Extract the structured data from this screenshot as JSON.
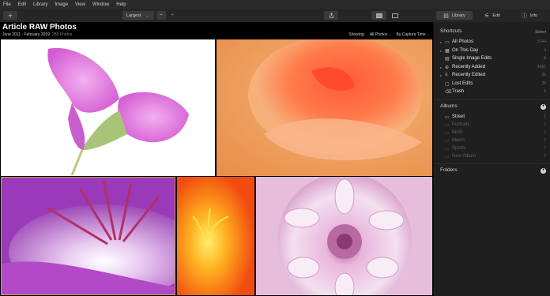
{
  "menu": [
    "File",
    "Edit",
    "Library",
    "Image",
    "View",
    "Window",
    "Help"
  ],
  "toolbar": {
    "add_label": "+",
    "size_select": "Largest",
    "zoom_out": "−",
    "zoom_in": "+",
    "share_icon": "share-icon",
    "view_grid_icon": "grid-view-icon",
    "view_single_icon": "single-view-icon"
  },
  "right_tabs": [
    {
      "label": "Library",
      "icon": "library-icon",
      "active": true
    },
    {
      "label": "Edit",
      "icon": "edit-icon",
      "active": false
    },
    {
      "label": "Info",
      "icon": "info-icon",
      "active": false
    }
  ],
  "gallery": {
    "title": "Article RAW Photos",
    "date_range": "June 2011 - February 2019",
    "photo_count": "288 Photos",
    "showing_label": "Showing:",
    "showing_value": "All Photos",
    "sort_value": "By Capture Time"
  },
  "shortcuts": {
    "title": "Shortcuts",
    "action": "Select",
    "items": [
      {
        "label": "All Photos",
        "count": "5744",
        "icon": "photos-icon",
        "expandable": true
      },
      {
        "label": "On This Day",
        "count": "4",
        "icon": "calendar-icon",
        "expandable": true
      },
      {
        "label": "Single Image Edits",
        "count": "8",
        "icon": "single-image-icon",
        "expandable": false
      },
      {
        "label": "Recently Added",
        "count": "4391",
        "icon": "recently-added-icon",
        "expandable": true
      },
      {
        "label": "Recently Edited",
        "count": "26",
        "icon": "recently-edited-icon",
        "expandable": true
      },
      {
        "label": "Lost Edits",
        "count": "25",
        "icon": "lost-edits-icon",
        "expandable": false
      },
      {
        "label": "Trash",
        "count": "6",
        "icon": "trash-icon",
        "expandable": false
      }
    ]
  },
  "albums": {
    "title": "Albums",
    "items": [
      {
        "label": "Street",
        "count": "1",
        "dim": false
      },
      {
        "label": "Portraits",
        "count": "0",
        "dim": true
      },
      {
        "label": "Birds",
        "count": "0",
        "dim": true
      },
      {
        "label": "Macro",
        "count": "0",
        "dim": true
      },
      {
        "label": "Sports",
        "count": "0",
        "dim": true
      },
      {
        "label": "New Album",
        "count": "0",
        "dim": true
      }
    ]
  },
  "folders": {
    "title": "Folders"
  },
  "colors": {
    "background": "#1b1b1b",
    "sidebar": "#1f1f1f",
    "selection": "#c8a13a"
  }
}
